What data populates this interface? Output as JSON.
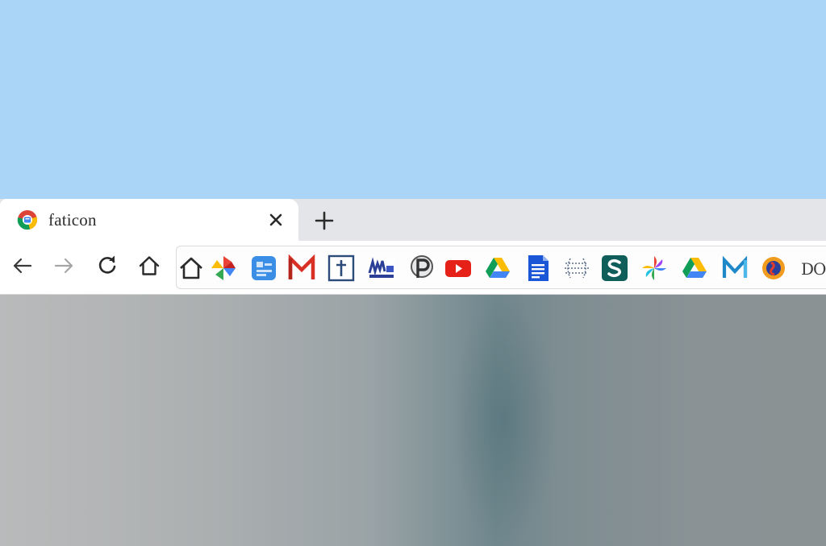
{
  "tab": {
    "title": "faticon",
    "favicon": "chrome-favicon",
    "close_icon": "close-icon"
  },
  "tabstrip": {
    "new_tab_icon": "plus-icon"
  },
  "toolbar": {
    "back_icon": "arrow-left-icon",
    "forward_icon": "arrow-right-icon",
    "reload_icon": "reload-icon",
    "home_icon": "home-icon"
  },
  "bookmarks": [
    {
      "icon": "home-icon"
    },
    {
      "icon": "photos-pinwheel-icon"
    },
    {
      "icon": "blue-app-icon"
    },
    {
      "icon": "gmail-icon"
    },
    {
      "icon": "cross-box-icon"
    },
    {
      "icon": "chart-app-icon"
    },
    {
      "icon": "p-logo-icon"
    },
    {
      "icon": "youtube-icon"
    },
    {
      "icon": "google-drive-icon"
    },
    {
      "icon": "google-docs-icon"
    },
    {
      "icon": "dotted-globe-icon"
    },
    {
      "icon": "s-logo-icon"
    },
    {
      "icon": "google-photos-icon"
    },
    {
      "icon": "google-drive-icon"
    },
    {
      "icon": "m-logo-icon"
    },
    {
      "icon": "badge-logo-icon"
    }
  ],
  "bookmark_overflow_text": "DOOO",
  "colors": {
    "sky": "#abd5f6",
    "tabstrip": "#e3e5e8",
    "tab": "#ffffff",
    "toolbar": "#ffffff"
  }
}
